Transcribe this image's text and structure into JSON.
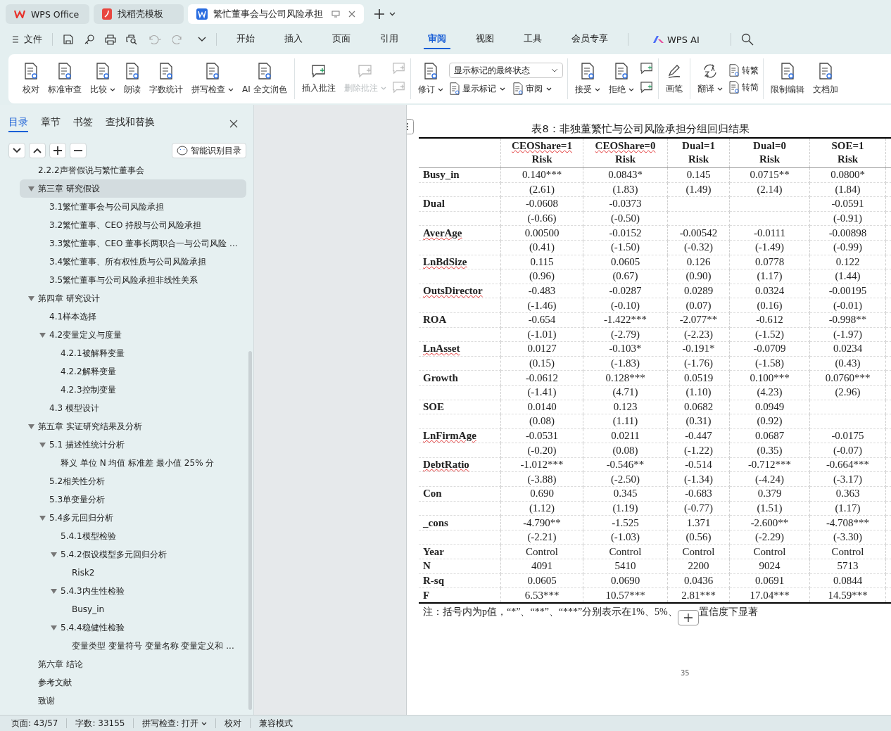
{
  "app_tabs": [
    {
      "label": "WPS Office",
      "selected": false
    },
    {
      "label": "找稻壳模板",
      "selected": false
    },
    {
      "label": "繁忙董事会与公司风险承担",
      "selected": true
    }
  ],
  "menu": {
    "file": "文件",
    "tabs": [
      {
        "label": "开始",
        "selected": false
      },
      {
        "label": "插入",
        "selected": false
      },
      {
        "label": "页面",
        "selected": false
      },
      {
        "label": "引用",
        "selected": false
      },
      {
        "label": "审阅",
        "selected": true
      },
      {
        "label": "视图",
        "selected": false
      },
      {
        "label": "工具",
        "selected": false
      },
      {
        "label": "会员专享",
        "selected": false
      }
    ],
    "ai": "WPS AI"
  },
  "ribbon": {
    "groups": [
      {
        "items": [
          {
            "kind": "large",
            "label": "校对",
            "dropdown": false,
            "disabled": false
          },
          {
            "kind": "large",
            "label": "标准审查",
            "dropdown": false,
            "disabled": false
          },
          {
            "kind": "large",
            "label": "比较",
            "dropdown": true,
            "disabled": false
          },
          {
            "kind": "large",
            "label": "朗读",
            "dropdown": false,
            "disabled": false
          },
          {
            "kind": "large",
            "label": "字数统计",
            "dropdown": false,
            "disabled": false
          },
          {
            "kind": "large",
            "label": "拼写检查",
            "dropdown": true,
            "disabled": false
          },
          {
            "kind": "large",
            "label": "AI 全文润色",
            "dropdown": false,
            "disabled": false
          }
        ]
      },
      {
        "items": [
          {
            "kind": "large",
            "label": "插入批注",
            "dropdown": false,
            "disabled": false
          },
          {
            "kind": "large",
            "label": "删除批注",
            "dropdown": true,
            "disabled": true
          },
          {
            "kind": "column",
            "items": [
              {
                "kind": "icon",
                "disabled": true
              },
              {
                "kind": "icon",
                "disabled": true
              }
            ]
          }
        ]
      },
      {
        "items": [
          {
            "kind": "large",
            "label": "修订",
            "dropdown": true,
            "disabled": false
          },
          {
            "kind": "column",
            "items": [
              {
                "kind": "select",
                "label": "显示标记的最终状态"
              },
              {
                "kind": "pair",
                "items": [
                  {
                    "kind": "small",
                    "label": "显示标记",
                    "dropdown": true,
                    "disabled": false
                  },
                  {
                    "kind": "small",
                    "label": "审阅",
                    "dropdown": true,
                    "disabled": false
                  }
                ]
              }
            ]
          }
        ]
      },
      {
        "items": [
          {
            "kind": "large",
            "label": "接受",
            "dropdown": true,
            "disabled": false
          },
          {
            "kind": "large",
            "label": "拒绝",
            "dropdown": true,
            "disabled": false
          },
          {
            "kind": "column",
            "items": [
              {
                "kind": "icon",
                "disabled": false
              },
              {
                "kind": "icon",
                "disabled": false
              }
            ]
          }
        ]
      },
      {
        "items": [
          {
            "kind": "large",
            "label": "画笔",
            "dropdown": false,
            "disabled": false
          }
        ]
      },
      {
        "items": [
          {
            "kind": "large",
            "label": "翻译",
            "dropdown": true,
            "disabled": false
          },
          {
            "kind": "column",
            "items": [
              {
                "kind": "small",
                "label": "转繁",
                "dropdown": false,
                "disabled": false
              },
              {
                "kind": "small",
                "label": "转简",
                "dropdown": false,
                "disabled": false
              }
            ]
          }
        ]
      },
      {
        "items": [
          {
            "kind": "large",
            "label": "限制编辑",
            "dropdown": false,
            "disabled": false
          },
          {
            "kind": "large",
            "label": "文档加",
            "dropdown": false,
            "disabled": false
          }
        ]
      }
    ]
  },
  "sidebar": {
    "tabs": [
      {
        "label": "目录",
        "selected": true
      },
      {
        "label": "章节",
        "selected": false
      },
      {
        "label": "书签",
        "selected": false
      },
      {
        "label": "查找和替换",
        "selected": false
      }
    ],
    "smart_button": "智能识别目录",
    "tree": [
      {
        "label": "2.2.2声誉假说与繁忙董事会",
        "selected": false
      },
      {
        "label": "第三章 研究假设",
        "selected": true,
        "expanded": true,
        "children": [
          {
            "label": "3.1繁忙董事会与公司风险承担",
            "selected": false
          },
          {
            "label": "3.2繁忙董事、CEO 持股与公司风险承担",
            "selected": false
          },
          {
            "label": "3.3繁忙董事、CEO 董事长两职合一与公司风险 ...",
            "selected": false
          },
          {
            "label": "3.4繁忙董事、所有权性质与公司风险承担",
            "selected": false
          },
          {
            "label": "3.5繁忙董事与公司风险承担非线性关系",
            "selected": false
          }
        ]
      },
      {
        "label": "第四章 研究设计",
        "selected": false,
        "expanded": true,
        "children": [
          {
            "label": "4.1样本选择",
            "selected": false
          },
          {
            "label": "4.2变量定义与度量",
            "selected": false,
            "expanded": true,
            "children": [
              {
                "label": "4.2.1被解释变量",
                "selected": false
              },
              {
                "label": "4.2.2解释变量",
                "selected": false
              },
              {
                "label": "4.2.3控制变量",
                "selected": false
              }
            ]
          },
          {
            "label": "4.3 模型设计",
            "selected": false
          }
        ]
      },
      {
        "label": "第五章 实证研究结果及分析",
        "selected": false,
        "expanded": true,
        "children": [
          {
            "label": "5.1 描述性统计分析",
            "selected": false,
            "expanded": true,
            "children": [
              {
                "label": "释义 单位 N 均值 标准差 最小值 25% 分",
                "selected": false
              }
            ]
          },
          {
            "label": "5.2相关性分析",
            "selected": false
          },
          {
            "label": "5.3单变量分析",
            "selected": false
          },
          {
            "label": "5.4多元回归分析",
            "selected": false,
            "expanded": true,
            "children": [
              {
                "label": "5.4.1模型检验",
                "selected": false
              },
              {
                "label": "5.4.2假设模型多元回归分析",
                "selected": false,
                "expanded": true,
                "children": [
                  {
                    "label": "Risk2",
                    "selected": false
                  }
                ]
              },
              {
                "label": "5.4.3内生性检验",
                "selected": false,
                "expanded": true,
                "children": [
                  {
                    "label": "Busy_in",
                    "selected": false
                  }
                ]
              },
              {
                "label": "5.4.4稳健性检验",
                "selected": false,
                "expanded": true,
                "children": [
                  {
                    "label": "变量类型 变量符号 变量名称 变量定义和 ...",
                    "selected": false
                  }
                ]
              }
            ]
          }
        ]
      },
      {
        "label": "第六章 结论",
        "selected": false
      },
      {
        "label": "参考文献",
        "selected": false
      },
      {
        "label": "致谢",
        "selected": false
      }
    ]
  },
  "document": {
    "table_title": "表8：非独董繁忙与公司风险承担分组回归结果",
    "columns": [
      {
        "line1": "CEOShare=1",
        "line2": "Risk",
        "misspelled": true
      },
      {
        "line1": "CEOShare=0",
        "line2": "Risk",
        "misspelled": true
      },
      {
        "line1": "Dual=1",
        "line2": "Risk",
        "misspelled": false
      },
      {
        "line1": "Dual=0",
        "line2": "Risk",
        "misspelled": false
      },
      {
        "line1": "SOE=1",
        "line2": "Risk",
        "misspelled": false
      }
    ],
    "rows": [
      {
        "kind": "variable",
        "label": "Busy_in",
        "misspelled": false,
        "coefficients": [
          "0.140***",
          "0.0843*",
          "0.145",
          "0.0715**",
          "0.0800*"
        ],
        "t_stats": [
          "(2.61)",
          "(1.83)",
          "(1.49)",
          "(2.14)",
          "(1.84)"
        ]
      },
      {
        "kind": "variable",
        "label": "Dual",
        "misspelled": false,
        "cells": [
          {
            "coefficient": "-0.0608",
            "t_stat": "(-0.66)"
          },
          {
            "coefficient": "-0.0373",
            "t_stat": "(-0.50)"
          },
          {},
          {},
          {
            "coefficient": "-0.0591",
            "t_stat": "(-0.91)"
          }
        ]
      },
      {
        "kind": "variable",
        "label": "AverAge",
        "misspelled": true,
        "coefficients": [
          "0.00500",
          "-0.0152",
          "-0.00542",
          "-0.0111",
          "-0.00898"
        ],
        "t_stats": [
          "(0.41)",
          "(-1.50)",
          "(-0.32)",
          "(-1.49)",
          "(-0.99)"
        ]
      },
      {
        "kind": "variable",
        "label": "LnBdSize",
        "misspelled": true,
        "coefficients": [
          "0.115",
          "0.0605",
          "0.126",
          "0.0778",
          "0.122"
        ],
        "t_stats": [
          "(0.96)",
          "(0.67)",
          "(0.90)",
          "(1.17)",
          "(1.44)"
        ]
      },
      {
        "kind": "variable",
        "label": "OutsDirector",
        "misspelled": true,
        "coefficients": [
          "-0.483",
          "-0.0287",
          "0.0289",
          "0.0324",
          "-0.00195"
        ],
        "t_stats": [
          "(-1.46)",
          "(-0.10)",
          "(0.07)",
          "(0.16)",
          "(-0.01)"
        ]
      },
      {
        "kind": "variable",
        "label": "ROA",
        "misspelled": false,
        "coefficients": [
          "-0.654",
          "-1.422***",
          "-2.077**",
          "-0.612",
          "-0.998**"
        ],
        "t_stats": [
          "(-1.01)",
          "(-2.79)",
          "(-2.23)",
          "(-1.52)",
          "(-1.97)"
        ]
      },
      {
        "kind": "variable",
        "label": "LnAsset",
        "misspelled": true,
        "coefficients": [
          "0.0127",
          "-0.103*",
          "-0.191*",
          "-0.0709",
          "0.0234"
        ],
        "t_stats": [
          "(0.15)",
          "(-1.83)",
          "(-1.76)",
          "(-1.58)",
          "(0.43)"
        ]
      },
      {
        "kind": "variable",
        "label": "Growth",
        "misspelled": false,
        "coefficients": [
          "-0.0612",
          "0.128***",
          "0.0519",
          "0.100***",
          "0.0760***"
        ],
        "t_stats": [
          "(-1.41)",
          "(4.71)",
          "(1.10)",
          "(4.23)",
          "(2.96)"
        ]
      },
      {
        "kind": "variable",
        "label": "SOE",
        "misspelled": false,
        "cells": [
          {
            "coefficient": "0.0140",
            "t_stat": "(0.08)"
          },
          {
            "coefficient": "0.123",
            "t_stat": "(1.11)"
          },
          {
            "coefficient": "0.0682",
            "t_stat": "(0.31)"
          },
          {
            "coefficient": "0.0949",
            "t_stat": "(0.92)"
          },
          {}
        ]
      },
      {
        "kind": "variable",
        "label": "LnFirmAge",
        "misspelled": true,
        "coefficients": [
          "-0.0531",
          "0.0211",
          "-0.447",
          "0.0687",
          "-0.0175"
        ],
        "t_stats": [
          "(-0.20)",
          "(0.08)",
          "(-1.22)",
          "(0.35)",
          "(-0.07)"
        ]
      },
      {
        "kind": "variable",
        "label": "DebtRatio",
        "misspelled": true,
        "coefficients": [
          "-1.012***",
          "-0.546**",
          "-0.514",
          "-0.712***",
          "-0.664***"
        ],
        "t_stats": [
          "(-3.88)",
          "(-2.50)",
          "(-1.34)",
          "(-4.24)",
          "(-3.17)"
        ]
      },
      {
        "kind": "variable",
        "label": "Con",
        "misspelled": false,
        "coefficients": [
          "0.690",
          "0.345",
          "-0.683",
          "0.379",
          "0.363"
        ],
        "t_stats": [
          "(1.12)",
          "(1.19)",
          "(-0.77)",
          "(1.51)",
          "(1.17)"
        ]
      },
      {
        "kind": "variable",
        "label": "_cons",
        "misspelled": false,
        "coefficients": [
          "-4.790**",
          "-1.525",
          "1.371",
          "-2.600**",
          "-4.708***"
        ],
        "t_stats": [
          "(-2.21)",
          "(-1.03)",
          "(0.56)",
          "(-2.29)",
          "(-3.30)"
        ]
      },
      {
        "kind": "statistic",
        "label": "Year",
        "misspelled": false,
        "values": [
          "Control",
          "Control",
          "Control",
          "Control",
          "Control"
        ]
      },
      {
        "kind": "statistic",
        "label": "N",
        "misspelled": false,
        "values": [
          "4091",
          "5410",
          "2200",
          "9024",
          "5713"
        ]
      },
      {
        "kind": "statistic",
        "label": "R-sq",
        "misspelled": false,
        "values": [
          "0.0605",
          "0.0690",
          "0.0436",
          "0.0691",
          "0.0844"
        ]
      },
      {
        "kind": "statistic",
        "label": "F",
        "misspelled": false,
        "values": [
          "6.53***",
          "10.57***",
          "2.81***",
          "17.04***",
          "14.59***"
        ]
      }
    ],
    "note_before": "注：括号内为p值，“*”、“**”、“***”分别表示在1%、5%、",
    "note_after": "置信度下显著",
    "page_number": "35"
  },
  "status_bar": {
    "page": "页面: 43/57",
    "words": "字数: 33155",
    "spell": "拼写检查: 打开",
    "proof": "校对",
    "mode": "兼容模式"
  }
}
